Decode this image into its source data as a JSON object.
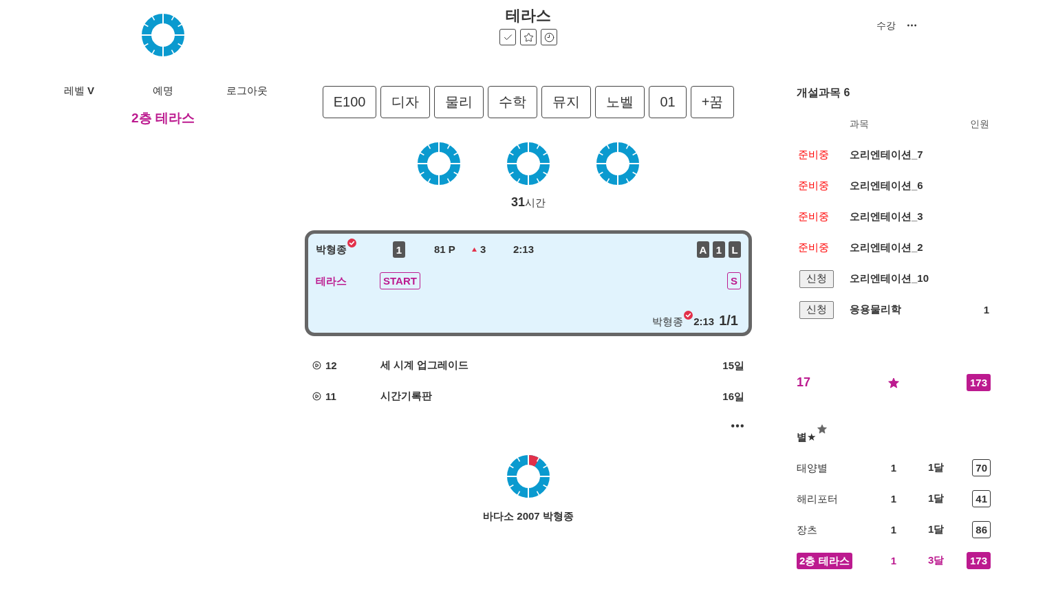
{
  "header": {
    "title": "테라스"
  },
  "nav": {
    "items": [
      {
        "label": "레벨 **V**"
      },
      {
        "label": "예명"
      },
      {
        "label": "로그아웃"
      }
    ],
    "location": "2층 테라스"
  },
  "tabs": [
    {
      "label": "E100"
    },
    {
      "label": "디자"
    },
    {
      "label": "물리"
    },
    {
      "label": "수학"
    },
    {
      "label": "뮤지"
    },
    {
      "label": "노벨"
    },
    {
      "label": "01"
    },
    {
      "label": "+꿈"
    }
  ],
  "hours": "**31**시간",
  "card": {
    "player": {
      "name": "박형종",
      "verified": true
    },
    "rank": "1",
    "points": "81 P",
    "change": {
      "kind": "up",
      "value": "3"
    },
    "time": "2:13",
    "badges": [
      "A",
      "1",
      "L"
    ],
    "team": "테라스",
    "start": "START",
    "tag": "S",
    "footer": {
      "name": "박형종",
      "verified": true,
      "time": "2:13",
      "count": "1/1"
    }
  },
  "activity": [
    {
      "number": "12",
      "title": "세 시계 업그레이드",
      "days": "15일"
    },
    {
      "number": "11",
      "title": "시간기록판",
      "days": "16일"
    }
  ],
  "footer": {
    "text": "바다소 2007 박형종"
  },
  "menu": {
    "label": "수강"
  },
  "courses": {
    "title": "개설과목 6",
    "columns": [
      "과목",
      "인원"
    ],
    "rows": [
      {
        "status": {
          "kind": "label",
          "text": "준비중"
        },
        "subject": "오리엔테이션_7"
      },
      {
        "status": {
          "kind": "label",
          "text": "준비중"
        },
        "subject": "오리엔테이션_6"
      },
      {
        "status": {
          "kind": "label",
          "text": "준비중"
        },
        "subject": "오리엔테이션_3"
      },
      {
        "status": {
          "kind": "label",
          "text": "준비중"
        },
        "subject": "오리엔테이션_2"
      },
      {
        "status": {
          "kind": "button",
          "text": "신청"
        },
        "subject": "오리엔테이션_10"
      },
      {
        "status": {
          "kind": "button",
          "text": "신청"
        },
        "subject": "응용물리학",
        "count": "1"
      }
    ]
  },
  "summary": {
    "count": "17",
    "total": "173"
  },
  "stars": {
    "title": "별★",
    "rows": [
      {
        "name": "태양별",
        "count": "1",
        "period": "1달",
        "score": "70",
        "selected": false
      },
      {
        "name": "해리포터",
        "count": "1",
        "period": "1달",
        "score": "41",
        "selected": false
      },
      {
        "name": "장츠",
        "count": "1",
        "period": "1달",
        "score": "86",
        "selected": false
      },
      {
        "name": "2층 테라스",
        "count": "1",
        "period": "3달",
        "score": "173",
        "selected": true
      }
    ]
  }
}
